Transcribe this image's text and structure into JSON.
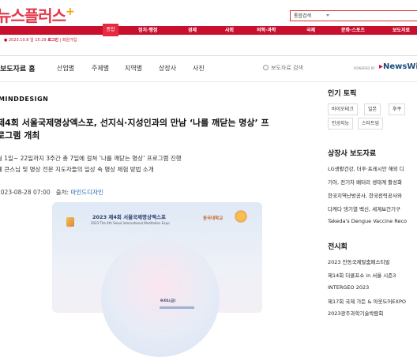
{
  "site": {
    "logo": "뉴스플러스",
    "logo_plus": "+",
    "search_placeholder": "통합검색",
    "nav": [
      "종합",
      "정치·행정",
      "경제",
      "사회",
      "의학·과학",
      "국제",
      "문화·스포츠",
      "보도자료"
    ],
    "date": "2023.10.8 일 15:29",
    "login": "로그인",
    "join": "회원가입"
  },
  "pr_header": {
    "title": "보도자료 홈",
    "nav": [
      "산업별",
      "주제별",
      "지역별",
      "상장사",
      "사진"
    ],
    "search_placeholder": "보도자료 검색",
    "powered": "POWERED BY",
    "brand": "NewsWir"
  },
  "article": {
    "brand": "MINDDESIGN",
    "title_line1": "제4회 서울국제명상엑스포, 선지식·지성인과의 만남 ‘나를 깨닫는 명상’ 프",
    "title_line2": "로그램 개최",
    "summary_line1": "월 1일~ 22일까지 3주간 총 7일에 걸쳐 ‘나를 깨닫는 명상’ 프로그램 진행",
    "summary_line2": "계 큰스님 및 명상 전문 지도자들의 일상 속 명상 체험 방법 소개",
    "date": "2023-08-28 07:00",
    "source_label": "출처:",
    "source": "마인드디자인",
    "poster": {
      "title": "2023 제4회 서울국제명상엑스포",
      "subtitle": "2023 The 4th Seoul International Meditation Expo",
      "org": "동국대학교",
      "date": "9/01(금)"
    }
  },
  "sidebar": {
    "topics_heading": "인기 토픽",
    "topics": [
      "바이오테크",
      "일본",
      "후쿠",
      "인공지능",
      "스타트업"
    ],
    "listed_heading": "상장사 보도자료",
    "listed": [
      "LG생활건강, 더후·프레시안 해외 디",
      "기아, 전기차 배터리 생태계 활성화",
      "한국지역난방공사, 한국전력공사와 ",
      "다케다 댕기열 백신, 세계보건기구 ",
      "Takeda's Dengue Vaccine Reco"
    ],
    "expo_heading": "전시회",
    "expos": [
      "2023 안동국제탈춤페스티벌",
      "제14회 더콜프쇼 in 서울 시즌3",
      "INTERGEO 2023",
      "제17회 국제 가든 & 아웃도어EXPO",
      "2023광주과학기술박람회"
    ]
  }
}
